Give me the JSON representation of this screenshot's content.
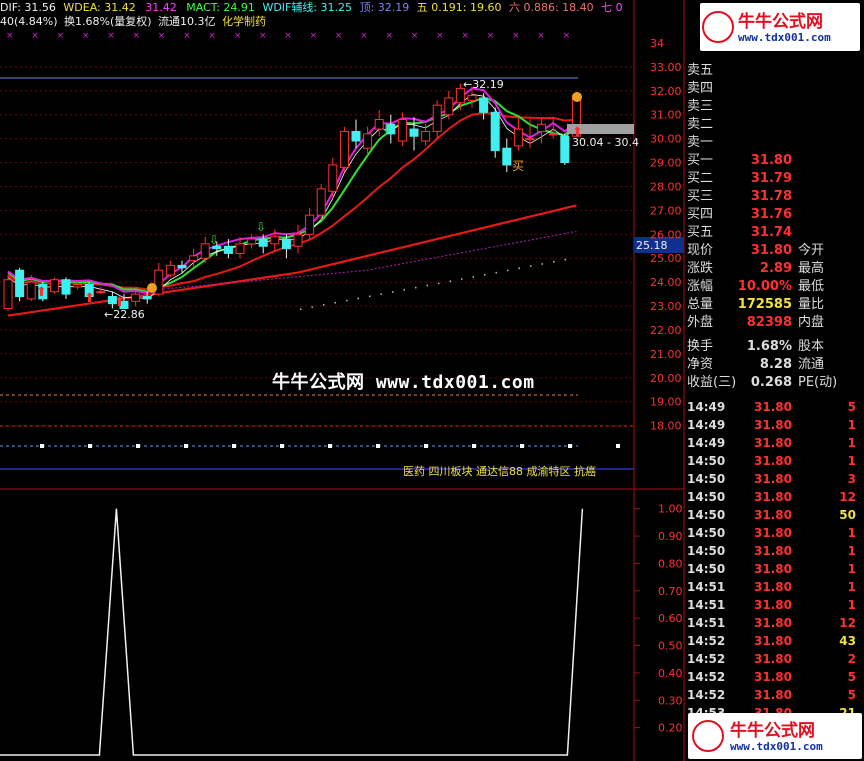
{
  "indicator_header": {
    "dif": "DIF: 31.56",
    "wdea": "WDEA: 31.42",
    "third": "31.42",
    "mact": "MACT: 24.91",
    "wdif": "WDIF辅线: 31.25",
    "ding": "顶: 32.19",
    "wu": "五 0.191: 19.60",
    "liu": "六 0.886: 18.40",
    "qi": "七 0"
  },
  "sub_header": {
    "change": "40(4.84%)",
    "turnover": "换1.68%(量复权)",
    "float": "流通10.3亿",
    "industry": "化学制药"
  },
  "watermark_mid": "牛牛公式网 www.tdx001.com",
  "sector_bar": "医药 四川板块 通达信88 成渝特区 抗癌",
  "logo": {
    "title": "牛牛公式网",
    "url": "www.tdx001.com"
  },
  "price_axis": [
    "34",
    "33.00",
    "32.00",
    "31.00",
    "30.00",
    "29.00",
    "28.00",
    "27.00",
    "26.00",
    "25.00",
    "24.00",
    "23.00",
    "22.00",
    "21.00",
    "20.00",
    "19.00",
    "18.00"
  ],
  "osc_axis": [
    "1.00",
    "0.90",
    "0.80",
    "0.70",
    "0.60",
    "0.50",
    "0.40",
    "0.30",
    "0.20"
  ],
  "labels": {
    "high": "32.19",
    "low": "22.86",
    "range": "30.04 - 30.4",
    "current": "25.18",
    "buy_mark": "买"
  },
  "order_book": [
    {
      "label": "卖五",
      "price": ""
    },
    {
      "label": "卖四",
      "price": ""
    },
    {
      "label": "卖三",
      "price": ""
    },
    {
      "label": "卖二",
      "price": ""
    },
    {
      "label": "卖一",
      "price": ""
    },
    {
      "label": "买一",
      "price": "31.80"
    },
    {
      "label": "买二",
      "price": "31.79"
    },
    {
      "label": "买三",
      "price": "31.78"
    },
    {
      "label": "买四",
      "price": "31.76"
    },
    {
      "label": "买五",
      "price": "31.74"
    }
  ],
  "stats": [
    {
      "l1": "现价",
      "v": "31.80",
      "c": "#ff3030",
      "l2": "今开"
    },
    {
      "l1": "涨跌",
      "v": "2.89",
      "c": "#ff3030",
      "l2": "最高"
    },
    {
      "l1": "涨幅",
      "v": "10.00%",
      "c": "#ff3030",
      "l2": "最低"
    },
    {
      "l1": "总量",
      "v": "172585",
      "c": "#f0e040",
      "l2": "量比"
    },
    {
      "l1": "外盘",
      "v": "82398",
      "c": "#ff3030",
      "l2": "内盘"
    },
    {
      "l1": "换手",
      "v": "1.68%",
      "c": "#dddddd",
      "l2": "股本"
    },
    {
      "l1": "净资",
      "v": "8.28",
      "c": "#dddddd",
      "l2": "流通"
    },
    {
      "l1": "收益(三)",
      "v": "0.268",
      "c": "#dddddd",
      "l2": "PE(动)"
    }
  ],
  "ticks": [
    {
      "t": "14:49",
      "p": "31.80",
      "v": "5"
    },
    {
      "t": "14:49",
      "p": "31.80",
      "v": "1"
    },
    {
      "t": "14:49",
      "p": "31.80",
      "v": "1"
    },
    {
      "t": "14:50",
      "p": "31.80",
      "v": "1"
    },
    {
      "t": "14:50",
      "p": "31.80",
      "v": "3"
    },
    {
      "t": "14:50",
      "p": "31.80",
      "v": "12"
    },
    {
      "t": "14:50",
      "p": "31.80",
      "v": "50"
    },
    {
      "t": "14:50",
      "p": "31.80",
      "v": "1"
    },
    {
      "t": "14:50",
      "p": "31.80",
      "v": "1"
    },
    {
      "t": "14:50",
      "p": "31.80",
      "v": "1"
    },
    {
      "t": "14:51",
      "p": "31.80",
      "v": "1"
    },
    {
      "t": "14:51",
      "p": "31.80",
      "v": "1"
    },
    {
      "t": "14:51",
      "p": "31.80",
      "v": "12"
    },
    {
      "t": "14:52",
      "p": "31.80",
      "v": "43"
    },
    {
      "t": "14:52",
      "p": "31.80",
      "v": "2"
    },
    {
      "t": "14:52",
      "p": "31.80",
      "v": "5"
    },
    {
      "t": "14:52",
      "p": "31.80",
      "v": "5"
    },
    {
      "t": "14:53",
      "p": "31.80",
      "v": "21"
    }
  ],
  "colors": {
    "up": "#ff3030",
    "down": "#40f0f0",
    "ma_red": "#e81818",
    "ma_green": "#30e030",
    "ma_magenta": "#e020e0",
    "accent": "#f0e040"
  },
  "chart_data": {
    "type": "candlestick",
    "price_range": [
      17.4,
      34.5
    ],
    "candles": [
      [
        22.9,
        24.1,
        24.3,
        22.8
      ],
      [
        24.5,
        23.4,
        24.6,
        23.2
      ],
      [
        23.3,
        24.0,
        24.3,
        23.2
      ],
      [
        23.9,
        23.3,
        24.0,
        23.2
      ],
      [
        23.6,
        24.1,
        24.2,
        23.5
      ],
      [
        24.1,
        23.5,
        24.2,
        23.3
      ],
      [
        23.8,
        23.9,
        24.1,
        23.7
      ],
      [
        23.9,
        23.4,
        24.0,
        23.2
      ],
      [
        23.6,
        23.6,
        23.8,
        23.5
      ],
      [
        23.4,
        23.1,
        23.6,
        22.9
      ],
      [
        23.2,
        22.9,
        23.5,
        22.9
      ],
      [
        23.2,
        23.5,
        23.6,
        23.0
      ],
      [
        23.4,
        23.3,
        23.6,
        23.1
      ],
      [
        23.5,
        24.5,
        24.8,
        23.4
      ],
      [
        24.3,
        24.7,
        24.9,
        24.2
      ],
      [
        24.7,
        24.6,
        24.9,
        24.4
      ],
      [
        24.9,
        25.1,
        25.4,
        24.6
      ],
      [
        25.0,
        25.6,
        25.9,
        24.8
      ],
      [
        25.5,
        25.4,
        25.7,
        25.1
      ],
      [
        25.5,
        25.2,
        25.8,
        25.0
      ],
      [
        25.2,
        25.6,
        25.9,
        25.0
      ],
      [
        25.6,
        25.8,
        26.0,
        25.4
      ],
      [
        25.8,
        25.5,
        26.0,
        25.2
      ],
      [
        25.6,
        25.9,
        26.2,
        25.3
      ],
      [
        25.8,
        25.4,
        26.0,
        25.0
      ],
      [
        25.5,
        26.0,
        26.4,
        25.2
      ],
      [
        26.0,
        26.8,
        27.1,
        25.8
      ],
      [
        26.8,
        27.9,
        28.1,
        26.6
      ],
      [
        27.8,
        28.9,
        29.2,
        27.5
      ],
      [
        28.8,
        30.3,
        30.5,
        28.6
      ],
      [
        30.3,
        29.9,
        30.8,
        29.6
      ],
      [
        29.6,
        30.2,
        30.5,
        29.3
      ],
      [
        30.4,
        30.8,
        31.2,
        30.1
      ],
      [
        30.6,
        30.2,
        31.0,
        29.8
      ],
      [
        29.9,
        30.8,
        31.1,
        29.7
      ],
      [
        30.4,
        30.1,
        30.9,
        29.5
      ],
      [
        29.9,
        30.3,
        30.6,
        29.7
      ],
      [
        30.3,
        31.4,
        31.6,
        30.0
      ],
      [
        31.0,
        31.7,
        32.0,
        30.8
      ],
      [
        31.5,
        32.1,
        32.3,
        31.2
      ],
      [
        31.6,
        31.8,
        32.19,
        31.3
      ],
      [
        31.7,
        31.1,
        31.9,
        30.8
      ],
      [
        31.1,
        29.5,
        31.3,
        29.2
      ],
      [
        29.6,
        28.9,
        30.0,
        28.6
      ],
      [
        29.7,
        30.4,
        30.9,
        29.5
      ],
      [
        30.0,
        30.0,
        30.8,
        29.6
      ],
      [
        30.3,
        30.6,
        30.9,
        29.8
      ],
      [
        30.2,
        30.2,
        30.9,
        30.0
      ],
      [
        30.1,
        29.0,
        30.2,
        28.9
      ],
      [
        30.1,
        31.8,
        31.8,
        30.1
      ]
    ],
    "oscillator": {
      "range": [
        0.1,
        1.05
      ],
      "spikes_at": [
        9,
        49
      ]
    }
  }
}
